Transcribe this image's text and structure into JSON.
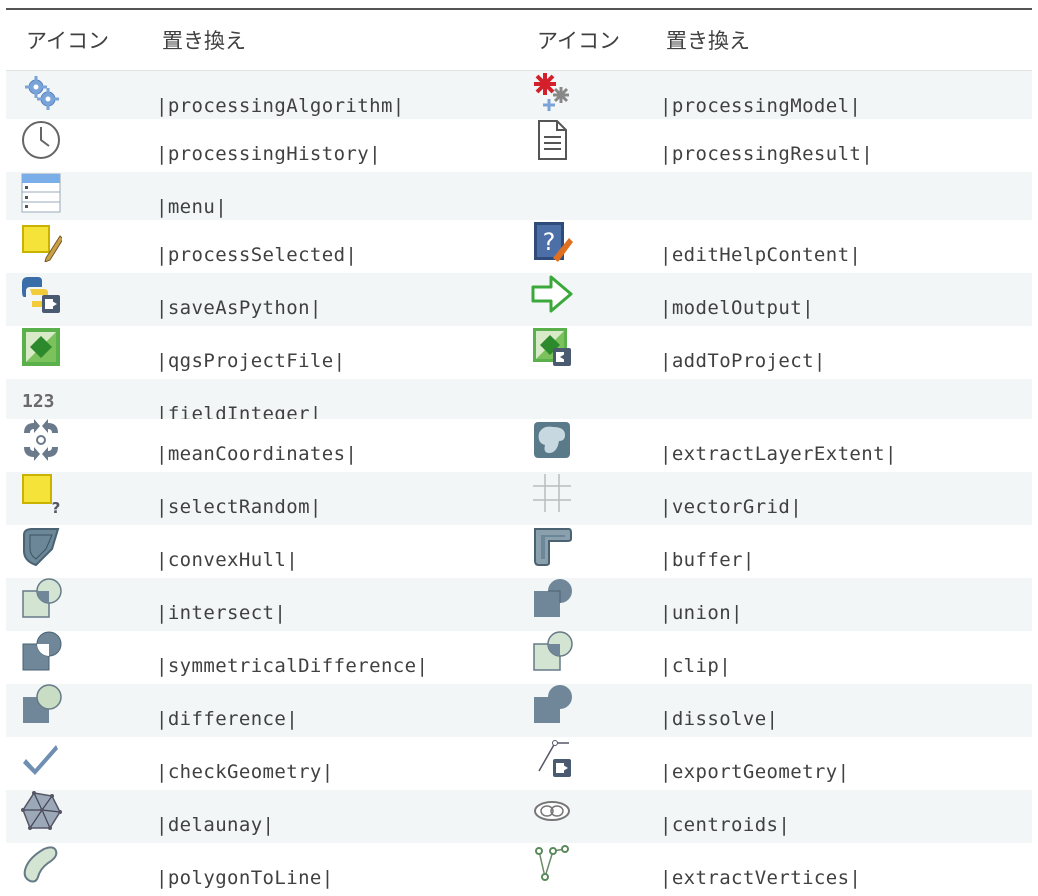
{
  "header": {
    "icon_col": "アイコン",
    "replace_col": "置き換え"
  },
  "rows": [
    {
      "left": {
        "icon": "processing-algorithm-icon",
        "text": "|processingAlgorithm|"
      },
      "right": {
        "icon": "processing-model-icon",
        "text": "|processingModel|"
      }
    },
    {
      "left": {
        "icon": "processing-history-icon",
        "text": "|processingHistory|"
      },
      "right": {
        "icon": "processing-result-icon",
        "text": "|processingResult|"
      }
    },
    {
      "left": {
        "icon": "menu-icon",
        "text": "|menu|"
      },
      "right": null
    },
    {
      "left": {
        "icon": "process-selected-icon",
        "text": "|processSelected|"
      },
      "right": {
        "icon": "edit-help-content-icon",
        "text": "|editHelpContent|"
      }
    },
    {
      "left": {
        "icon": "save-as-python-icon",
        "text": "|saveAsPython|"
      },
      "right": {
        "icon": "model-output-icon",
        "text": "|modelOutput|"
      }
    },
    {
      "left": {
        "icon": "qgs-project-file-icon",
        "text": "|qgsProjectFile|"
      },
      "right": {
        "icon": "add-to-project-icon",
        "text": "|addToProject|"
      }
    },
    {
      "left": {
        "icon": "field-integer-icon",
        "text": "|fieldInteger|",
        "icon_text": "123"
      },
      "right": null
    },
    {
      "left": {
        "icon": "mean-coordinates-icon",
        "text": "|meanCoordinates|"
      },
      "right": {
        "icon": "extract-layer-extent-icon",
        "text": "|extractLayerExtent|"
      }
    },
    {
      "left": {
        "icon": "select-random-icon",
        "text": "|selectRandom|"
      },
      "right": {
        "icon": "vector-grid-icon",
        "text": "|vectorGrid|"
      }
    },
    {
      "left": {
        "icon": "convex-hull-icon",
        "text": "|convexHull|"
      },
      "right": {
        "icon": "buffer-icon",
        "text": "|buffer|"
      }
    },
    {
      "left": {
        "icon": "intersect-icon",
        "text": "|intersect|"
      },
      "right": {
        "icon": "union-icon",
        "text": "|union|"
      }
    },
    {
      "left": {
        "icon": "symmetrical-difference-icon",
        "text": "|symmetricalDifference|"
      },
      "right": {
        "icon": "clip-icon",
        "text": "|clip|"
      }
    },
    {
      "left": {
        "icon": "difference-icon",
        "text": "|difference|"
      },
      "right": {
        "icon": "dissolve-icon",
        "text": "|dissolve|"
      }
    },
    {
      "left": {
        "icon": "check-geometry-icon",
        "text": "|checkGeometry|"
      },
      "right": {
        "icon": "export-geometry-icon",
        "text": "|exportGeometry|"
      }
    },
    {
      "left": {
        "icon": "delaunay-icon",
        "text": "|delaunay|"
      },
      "right": {
        "icon": "centroids-icon",
        "text": "|centroids|"
      }
    },
    {
      "left": {
        "icon": "polygon-to-line-icon",
        "text": "|polygonToLine|"
      },
      "right": {
        "icon": "extract-vertices-icon",
        "text": "|extractVertices|"
      }
    }
  ]
}
